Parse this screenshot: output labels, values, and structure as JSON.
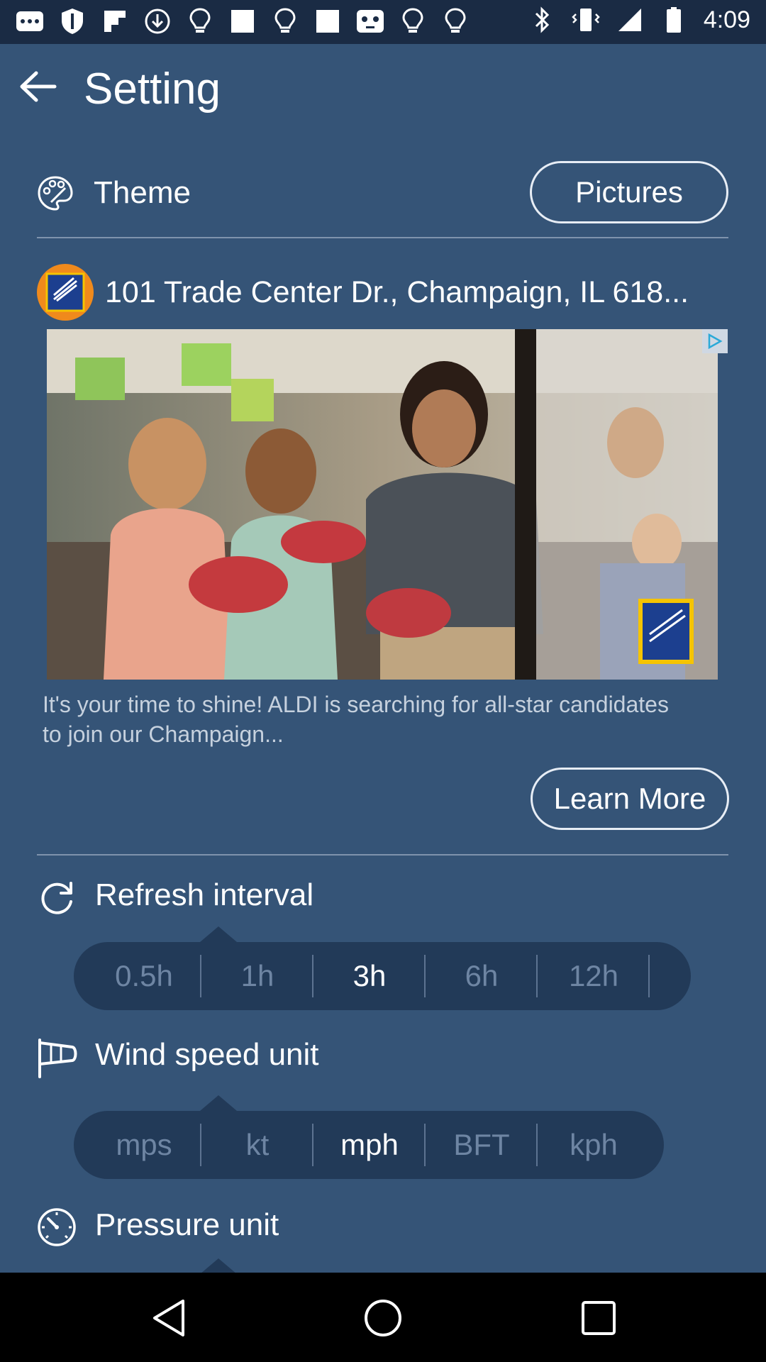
{
  "status_bar": {
    "time": "4:09",
    "left_icons": [
      "message-icon",
      "shield-icon",
      "flipboard-icon",
      "download-icon",
      "bulb-icon",
      "square-icon",
      "bulb-icon",
      "square-icon",
      "gamepad-icon",
      "bulb-icon",
      "bulb-icon"
    ],
    "right_icons": [
      "bluetooth-icon",
      "vibrate-icon",
      "signal-icon",
      "battery-icon"
    ]
  },
  "header": {
    "title": "Setting"
  },
  "theme": {
    "label": "Theme",
    "button_label": "Pictures"
  },
  "ad": {
    "logo_text": "ALDI",
    "title": "101 Trade Center Dr., Champaign, IL 618...",
    "body": "It's your time to shine! ALDI is searching for all-star candidates to join our Champaign...",
    "cta_label": "Learn More"
  },
  "refresh_interval": {
    "label": "Refresh interval",
    "options": [
      "0.5h",
      "1h",
      "3h",
      "6h",
      "12h"
    ],
    "selected": "3h"
  },
  "wind_speed_unit": {
    "label": "Wind speed unit",
    "options": [
      "mps",
      "kt",
      "mph",
      "BFT",
      "kph"
    ],
    "selected": "mph"
  },
  "pressure_unit": {
    "label": "Pressure unit"
  },
  "colors": {
    "background": "#355477",
    "segment_bg": "#223a58",
    "status_bar": "#1a2b44"
  }
}
